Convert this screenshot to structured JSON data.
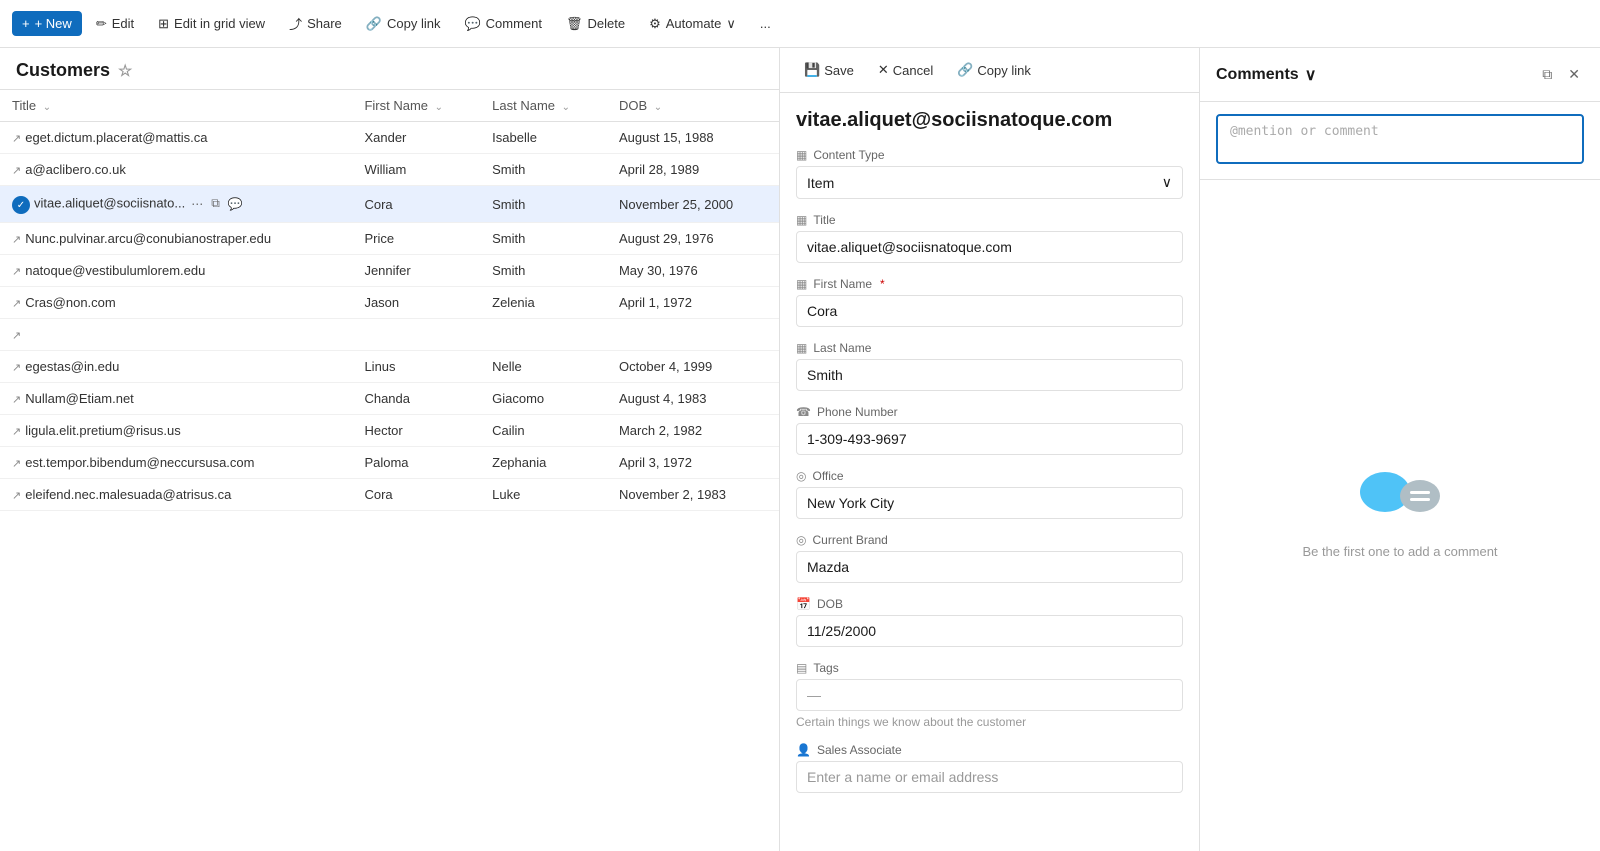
{
  "toolbar": {
    "new_label": "+ New",
    "edit_label": "Edit",
    "edit_grid_label": "Edit in grid view",
    "share_label": "Share",
    "copy_link_label": "Copy link",
    "comment_label": "Comment",
    "delete_label": "Delete",
    "automate_label": "Automate",
    "more_label": "..."
  },
  "list": {
    "title": "Customers",
    "columns": [
      {
        "id": "title",
        "label": "Title"
      },
      {
        "id": "first_name",
        "label": "First Name"
      },
      {
        "id": "last_name",
        "label": "Last Name"
      },
      {
        "id": "dob",
        "label": "DOB"
      }
    ],
    "rows": [
      {
        "id": 1,
        "title": "eget.dictum.placerat@mattis.ca",
        "first_name": "Xander",
        "last_name": "Isabelle",
        "dob": "August 15, 1988",
        "selected": false
      },
      {
        "id": 2,
        "title": "a@aclibero.co.uk",
        "first_name": "William",
        "last_name": "Smith",
        "dob": "April 28, 1989",
        "selected": false
      },
      {
        "id": 3,
        "title": "vitae.aliquet@sociisnato...",
        "first_name": "Cora",
        "last_name": "Smith",
        "dob": "November 25, 2000",
        "selected": true
      },
      {
        "id": 4,
        "title": "Nunc.pulvinar.arcu@conubianostraper.edu",
        "first_name": "Price",
        "last_name": "Smith",
        "dob": "August 29, 1976",
        "selected": false
      },
      {
        "id": 5,
        "title": "natoque@vestibulumlorem.edu",
        "first_name": "Jennifer",
        "last_name": "Smith",
        "dob": "May 30, 1976",
        "selected": false
      },
      {
        "id": 6,
        "title": "Cras@non.com",
        "first_name": "Jason",
        "last_name": "Zelenia",
        "dob": "April 1, 1972",
        "selected": false
      },
      {
        "id": 7,
        "title": "",
        "first_name": "",
        "last_name": "",
        "dob": "",
        "selected": false
      },
      {
        "id": 8,
        "title": "egestas@in.edu",
        "first_name": "Linus",
        "last_name": "Nelle",
        "dob": "October 4, 1999",
        "selected": false
      },
      {
        "id": 9,
        "title": "Nullam@Etiam.net",
        "first_name": "Chanda",
        "last_name": "Giacomo",
        "dob": "August 4, 1983",
        "selected": false
      },
      {
        "id": 10,
        "title": "ligula.elit.pretium@risus.us",
        "first_name": "Hector",
        "last_name": "Cailin",
        "dob": "March 2, 1982",
        "selected": false
      },
      {
        "id": 11,
        "title": "est.tempor.bibendum@neccursusa.com",
        "first_name": "Paloma",
        "last_name": "Zephania",
        "dob": "April 3, 1972",
        "selected": false
      },
      {
        "id": 12,
        "title": "eleifend.nec.malesuada@atrisus.ca",
        "first_name": "Cora",
        "last_name": "Luke",
        "dob": "November 2, 1983",
        "selected": false
      }
    ]
  },
  "detail": {
    "toolbar": {
      "save_label": "Save",
      "cancel_label": "Cancel",
      "copy_link_label": "Copy link"
    },
    "record_title": "vitae.aliquet@sociisnatoque.com",
    "fields": {
      "content_type_label": "Content Type",
      "content_type_value": "Item",
      "title_label": "Title",
      "title_value": "vitae.aliquet@sociisnatoque.com",
      "first_name_label": "First Name",
      "first_name_required": "*",
      "first_name_value": "Cora",
      "last_name_label": "Last Name",
      "last_name_value": "Smith",
      "phone_label": "Phone Number",
      "phone_value": "1-309-493-9697",
      "office_label": "Office",
      "office_value": "New York City",
      "current_brand_label": "Current Brand",
      "current_brand_value": "Mazda",
      "dob_label": "DOB",
      "dob_value": "11/25/2000",
      "tags_label": "Tags",
      "tags_value": "—",
      "tags_description": "Certain things we know about the customer",
      "sales_associate_label": "Sales Associate",
      "sales_associate_placeholder": "Enter a name or email address"
    }
  },
  "comments": {
    "title": "Comments",
    "input_placeholder": "@mention or comment",
    "empty_message": "Be the first one to add a comment"
  },
  "icons": {
    "save": "💾",
    "cancel": "✕",
    "copy_link": "🔗",
    "new": "+",
    "edit": "✏",
    "grid": "⊞",
    "share": "⤴",
    "comment": "💬",
    "delete": "🗑",
    "automate": "⚙",
    "star": "☆",
    "chevron_down": "∨",
    "content_type": "▦",
    "title_field": "▦",
    "text_field": "▦",
    "phone_field": "☎",
    "globe_field": "◎",
    "brand_field": "◎",
    "calendar": "📅",
    "tag": "▤",
    "person": "👤",
    "sort": "⌄",
    "chat_icon": "💬",
    "maximize": "⧉",
    "close": "✕"
  }
}
